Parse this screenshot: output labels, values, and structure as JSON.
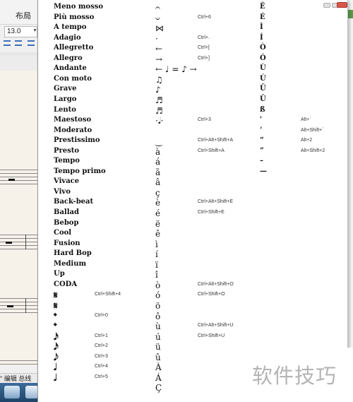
{
  "background": {
    "tab_layout": "布局",
    "font_size": "13.0",
    "status_text": "\" 编辑 总线"
  },
  "menu_columns": {
    "col1": [
      {
        "label": "Meno mosso",
        "shortcut": ""
      },
      {
        "label": "Più mosso",
        "shortcut": ""
      },
      {
        "label": "A tempo",
        "shortcut": ""
      },
      {
        "label": "Adagio",
        "shortcut": ""
      },
      {
        "label": "Allegretto",
        "shortcut": ""
      },
      {
        "label": "Allegro",
        "shortcut": ""
      },
      {
        "label": "Andante",
        "shortcut": ""
      },
      {
        "label": "Con moto",
        "shortcut": ""
      },
      {
        "label": "Grave",
        "shortcut": ""
      },
      {
        "label": "Largo",
        "shortcut": ""
      },
      {
        "label": "Lento",
        "shortcut": ""
      },
      {
        "label": "Maestoso",
        "shortcut": ""
      },
      {
        "label": "Moderato",
        "shortcut": ""
      },
      {
        "label": "Prestissimo",
        "shortcut": ""
      },
      {
        "label": "Presto",
        "shortcut": ""
      },
      {
        "label": "Tempo",
        "shortcut": ""
      },
      {
        "label": "Tempo primo",
        "shortcut": ""
      },
      {
        "label": "Vivace",
        "shortcut": ""
      },
      {
        "label": "Vivo",
        "shortcut": ""
      },
      {
        "label": "Back-beat",
        "shortcut": ""
      },
      {
        "label": "Ballad",
        "shortcut": ""
      },
      {
        "label": "Bebop",
        "shortcut": ""
      },
      {
        "label": "Cool",
        "shortcut": ""
      },
      {
        "label": "Fusion",
        "shortcut": ""
      },
      {
        "label": "Hard Bop",
        "shortcut": ""
      },
      {
        "label": "Medium",
        "shortcut": ""
      },
      {
        "label": "Up",
        "shortcut": ""
      },
      {
        "label": "CODA",
        "shortcut": ""
      },
      {
        "label": "𝄋",
        "shortcut": "Ctrl+Shift+4"
      },
      {
        "label": "𝄋",
        "shortcut": ""
      },
      {
        "label": "𝄌",
        "shortcut": "Ctrl+0"
      },
      {
        "label": "𝄌",
        "shortcut": ""
      },
      {
        "label": "𝅘𝅥𝅯",
        "shortcut": "Ctrl+1"
      },
      {
        "label": "𝅘𝅥𝅯",
        "shortcut": "Ctrl+2"
      },
      {
        "label": "𝅘𝅥𝅮",
        "shortcut": "Ctrl+3"
      },
      {
        "label": "𝅘𝅥",
        "shortcut": "Ctrl+4"
      },
      {
        "label": "𝅗𝅥",
        "shortcut": "Ctrl+5"
      }
    ],
    "col2": [
      {
        "label": "𝄐",
        "shortcut": ""
      },
      {
        "label": "𝄑",
        "shortcut": "Ctrl+6"
      },
      {
        "label": "⋈",
        "shortcut": ""
      },
      {
        "label": "·",
        "shortcut": "Ctrl+."
      },
      {
        "label": "←",
        "shortcut": "Ctrl+["
      },
      {
        "label": "→",
        "shortcut": "Ctrl+]"
      },
      {
        "label": "← ♩ = ♪ →",
        "shortcut": ""
      },
      {
        "label": "♫",
        "shortcut": ""
      },
      {
        "label": "♪",
        "shortcut": ""
      },
      {
        "label": "♬",
        "shortcut": ""
      },
      {
        "label": "♬",
        "shortcut": ""
      },
      {
        "label": "·𝅘𝅥·",
        "shortcut": "Ctrl+3"
      },
      {
        "label": "",
        "shortcut": ""
      },
      {
        "label": "‿",
        "shortcut": "Ctrl+Alt+Shift+A"
      },
      {
        "label": "à",
        "shortcut": "Ctrl+Shift+A"
      },
      {
        "label": "á",
        "shortcut": ""
      },
      {
        "label": "ã",
        "shortcut": ""
      },
      {
        "label": "â",
        "shortcut": ""
      },
      {
        "label": "ç",
        "shortcut": ""
      },
      {
        "label": "è",
        "shortcut": "Ctrl+Alt+Shift+E"
      },
      {
        "label": "é",
        "shortcut": "Ctrl+Shift+E"
      },
      {
        "label": "ë",
        "shortcut": ""
      },
      {
        "label": "ê",
        "shortcut": ""
      },
      {
        "label": "ì",
        "shortcut": ""
      },
      {
        "label": "í",
        "shortcut": ""
      },
      {
        "label": "ï",
        "shortcut": ""
      },
      {
        "label": "î",
        "shortcut": ""
      },
      {
        "label": "ò",
        "shortcut": "Ctrl+Alt+Shift+O"
      },
      {
        "label": "ó",
        "shortcut": "Ctrl+Shift+O"
      },
      {
        "label": "ö",
        "shortcut": ""
      },
      {
        "label": "ô",
        "shortcut": ""
      },
      {
        "label": "ù",
        "shortcut": "Ctrl+Alt+Shift+U"
      },
      {
        "label": "ú",
        "shortcut": "Ctrl+Shift+U"
      },
      {
        "label": "ü",
        "shortcut": ""
      },
      {
        "label": "û",
        "shortcut": ""
      },
      {
        "label": "À",
        "shortcut": ""
      },
      {
        "label": "Á",
        "shortcut": ""
      },
      {
        "label": "Ç",
        "shortcut": ""
      }
    ],
    "col3": [
      {
        "label": "Ê",
        "shortcut": ""
      },
      {
        "label": "É",
        "shortcut": ""
      },
      {
        "label": "Ì",
        "shortcut": ""
      },
      {
        "label": "Í",
        "shortcut": ""
      },
      {
        "label": "Ò",
        "shortcut": ""
      },
      {
        "label": "Ó",
        "shortcut": ""
      },
      {
        "label": "Ù",
        "shortcut": ""
      },
      {
        "label": "Ú",
        "shortcut": ""
      },
      {
        "label": "Ü",
        "shortcut": ""
      },
      {
        "label": "Û",
        "shortcut": ""
      },
      {
        "label": "ß",
        "shortcut": ""
      },
      {
        "label": "'",
        "shortcut": "Alt+`"
      },
      {
        "label": "’",
        "shortcut": "Alt+Shift+`"
      },
      {
        "label": "“",
        "shortcut": "Alt+2"
      },
      {
        "label": "”",
        "shortcut": "Alt+Shift+2"
      },
      {
        "label": "–",
        "shortcut": ""
      },
      {
        "label": "—",
        "shortcut": ""
      }
    ]
  },
  "watermark": "软件技巧"
}
